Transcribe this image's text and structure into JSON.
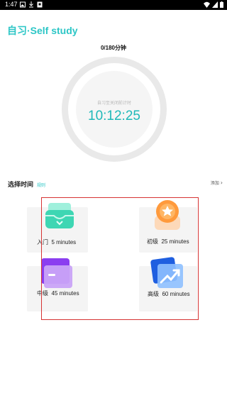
{
  "status_bar": {
    "time": "1:47"
  },
  "header": {
    "title": "自习·Self study"
  },
  "progress": {
    "text": "0/180分钟"
  },
  "timer": {
    "label": "自习至关闭前计时",
    "time": "10:12:25"
  },
  "section": {
    "title": "选择时间",
    "rule_link": "规则",
    "add_link": "添加",
    "add_chevron": "›"
  },
  "cards": [
    {
      "level": "入门",
      "duration": "5 minutes",
      "icon": "inbox-icon",
      "color": "#3ed6b3"
    },
    {
      "level": "初级",
      "duration": "25 minutes",
      "icon": "star-badge-icon",
      "color": "#ff9a3c"
    },
    {
      "level": "中级",
      "duration": "45 minutes",
      "icon": "folder-icon",
      "color": "#9b5cf0"
    },
    {
      "level": "高级",
      "duration": "60 minutes",
      "icon": "trend-chart-icon",
      "color": "#2f7cf5"
    }
  ]
}
